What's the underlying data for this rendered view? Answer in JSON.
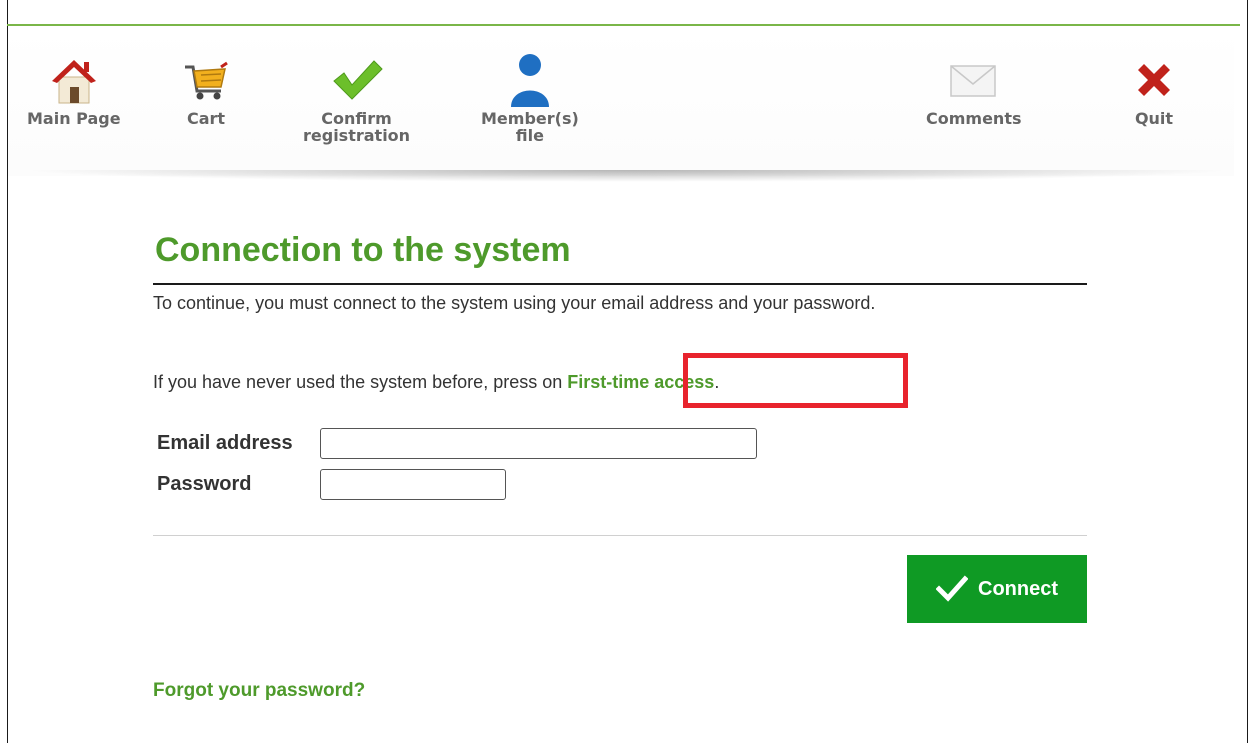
{
  "toolbar": {
    "items": [
      {
        "label": "Main Page",
        "icon": "home-icon"
      },
      {
        "label": "Cart",
        "icon": "cart-icon"
      },
      {
        "label": "Confirm\nregistration",
        "icon": "checkmark-icon"
      },
      {
        "label": "Member(s)\nfile",
        "icon": "user-icon"
      },
      {
        "label": "Comments",
        "icon": "envelope-icon"
      },
      {
        "label": "Quit",
        "icon": "close-icon"
      }
    ]
  },
  "main": {
    "title": "Connection to the system",
    "intro": "To continue, you must connect to the system using your email address and your password.",
    "first_time_prefix": "If you have never used the system before, press on ",
    "first_time_link": "First-time access",
    "first_time_suffix": ".",
    "email_label": "Email address",
    "email_value": "",
    "password_label": "Password",
    "password_value": "",
    "connect_label": "Connect",
    "forgot_link": "Forgot your password?"
  },
  "colors": {
    "accent_green": "#4e9a2b",
    "button_green": "#0f9a24",
    "highlight_red": "#e8232d",
    "top_rule_green": "#7ab648"
  }
}
